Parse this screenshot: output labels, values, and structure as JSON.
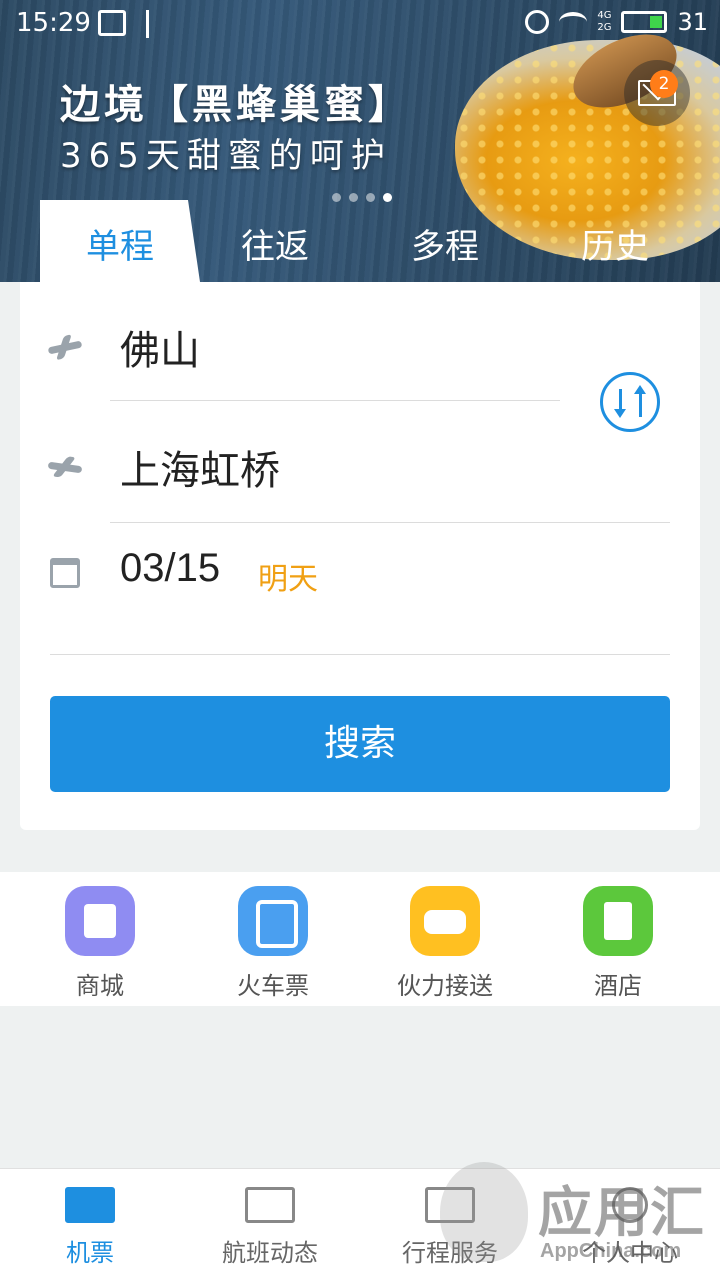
{
  "status_bar": {
    "time": "15:29",
    "battery": "31",
    "signal_labels": [
      "4G",
      "2G"
    ]
  },
  "banner": {
    "title": "边境【黑蜂巢蜜】",
    "subtitle": "365天甜蜜的呵护",
    "page_count": 4,
    "active_page": 4,
    "message_badge": "2"
  },
  "tabs": [
    {
      "label": "单程",
      "active": true
    },
    {
      "label": "往返",
      "active": false
    },
    {
      "label": "多程",
      "active": false
    },
    {
      "label": "历史",
      "active": false
    }
  ],
  "search_form": {
    "departure_city": "佛山",
    "arrival_city": "上海虹桥",
    "date": "03/15",
    "date_hint": "明天",
    "search_label": "搜索"
  },
  "services": [
    {
      "label": "商城",
      "icon": "shopping-bag-icon",
      "color": "#8f8cf2"
    },
    {
      "label": "火车票",
      "icon": "train-icon",
      "color": "#4a9ff0"
    },
    {
      "label": "伙力接送",
      "icon": "car-icon",
      "color": "#ffc021"
    },
    {
      "label": "酒店",
      "icon": "hotel-icon",
      "color": "#5cc83c"
    }
  ],
  "bottom_nav": [
    {
      "label": "机票",
      "icon": "ticket-icon",
      "active": true
    },
    {
      "label": "航班动态",
      "icon": "flight-status-icon",
      "active": false
    },
    {
      "label": "行程服务",
      "icon": "briefcase-icon",
      "active": false
    },
    {
      "label": "个人中心",
      "icon": "user-icon",
      "active": false
    }
  ],
  "watermark": {
    "text": "应用汇",
    "sub": "AppChina.com"
  },
  "colors": {
    "accent": "#1e8fe0",
    "date_hint": "#f0a014",
    "badge": "#ff7d18"
  }
}
